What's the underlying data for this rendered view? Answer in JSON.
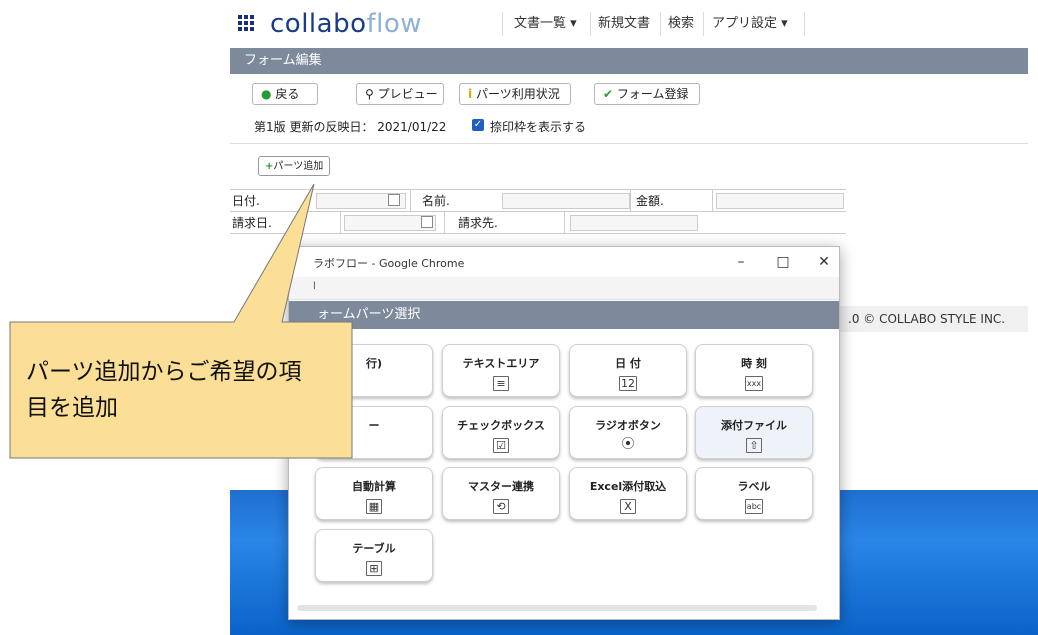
{
  "app": {
    "logo_main": "collabo",
    "logo_flow": "flow",
    "nav": [
      "文書一覧 ▾",
      "新規文書",
      "検索",
      "アプリ設定 ▾"
    ],
    "title": "フォーム編集",
    "toolbar": {
      "back": "戻る",
      "preview": "プレビュー",
      "parts_usage": "パーツ利用状況",
      "register": "フォーム登録"
    },
    "info_text": "第1版 更新の反映日： 2021/01/22",
    "checkbox_label": "捺印枠を表示する",
    "checkbox_checked": true,
    "add_parts": "パーツ追加",
    "form_rows": [
      [
        "日付.",
        "名前.",
        "金額."
      ],
      [
        "請求日.",
        "請求先."
      ]
    ],
    "footer": ".0 © COLLABO STYLE INC."
  },
  "popup": {
    "window_title": "ラボフロー - Google Chrome",
    "url_text": "l",
    "controls": [
      "–",
      "□",
      "✕"
    ],
    "header": "ォームパーツ選択",
    "parts": [
      {
        "label": "行)",
        "icon": "",
        "icon_name": "text-line-icon"
      },
      {
        "label": "テキストエリア",
        "icon": "≡",
        "icon_name": "textarea-icon"
      },
      {
        "label": "日 付",
        "icon": "12",
        "icon_name": "calendar-icon"
      },
      {
        "label": "時 刻",
        "icon": "xxx",
        "icon_name": "time-icon"
      },
      {
        "label": "ー",
        "icon": "",
        "icon_name": "dropdown-icon"
      },
      {
        "label": "チェックボックス",
        "icon": "☑",
        "icon_name": "checkbox-icon"
      },
      {
        "label": "ラジオボタン",
        "icon": "⦿",
        "icon_name": "radio-icon"
      },
      {
        "label": "添付ファイル",
        "icon": "⇧",
        "icon_name": "attachment-icon"
      },
      {
        "label": "自動計算",
        "icon": "▦",
        "icon_name": "calculator-icon"
      },
      {
        "label": "マスター連携",
        "icon": "⟲",
        "icon_name": "master-link-icon"
      },
      {
        "label": "Excel添付取込",
        "icon": "X",
        "icon_name": "excel-icon"
      },
      {
        "label": "ラベル",
        "icon": "abc",
        "icon_name": "label-icon"
      },
      {
        "label": "テーブル",
        "icon": "⊞",
        "icon_name": "table-icon"
      }
    ]
  },
  "callout": {
    "line1": "パーツ追加からご希望の項",
    "line2": "目を追加",
    "fill": "#fcdf97",
    "stroke": "#777777"
  }
}
